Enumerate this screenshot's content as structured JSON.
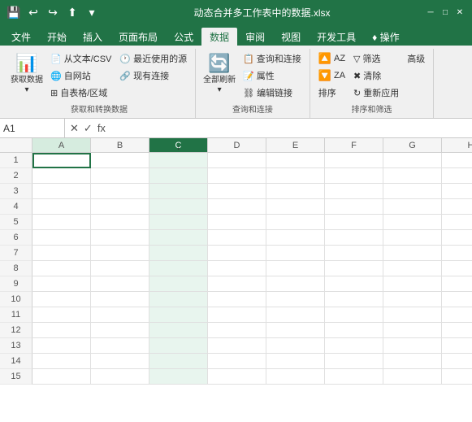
{
  "titlebar": {
    "filename": "动态合并多工作表中的数据.xlsx",
    "save_icon": "💾",
    "undo_icon": "↩",
    "redo_icon": "↪",
    "upload_icon": "⬆",
    "dropdown_icon": "▾"
  },
  "tabs": [
    {
      "label": "文件",
      "active": false
    },
    {
      "label": "开始",
      "active": false
    },
    {
      "label": "插入",
      "active": false
    },
    {
      "label": "页面布局",
      "active": false
    },
    {
      "label": "公式",
      "active": false
    },
    {
      "label": "数据",
      "active": true
    },
    {
      "label": "审阅",
      "active": false
    },
    {
      "label": "视图",
      "active": false
    },
    {
      "label": "开发工具",
      "active": false
    },
    {
      "label": "♦ 操作",
      "active": false
    }
  ],
  "ribbon": {
    "groups": [
      {
        "name": "获取和转换数据",
        "label": "获取和转换数据",
        "buttons": {
          "large": [
            {
              "label": "获取数据\n▾",
              "icon": "📊"
            }
          ],
          "small_col1": [
            {
              "label": "从文本/CSV",
              "icon": "📄"
            },
            {
              "label": "自网站",
              "icon": "🌐"
            },
            {
              "label": "自表格/区域",
              "icon": "⊞"
            }
          ],
          "small_col2": [
            {
              "label": "最近使用的源",
              "icon": "🕐"
            },
            {
              "label": "现有连接",
              "icon": "🔗"
            }
          ]
        }
      },
      {
        "name": "查询和连接",
        "label": "查询和连接",
        "buttons": {
          "large": [
            {
              "label": "全部刷新\n▾",
              "icon": "🔄"
            }
          ],
          "small_col1": [
            {
              "label": "查询和连接",
              "icon": "📋"
            },
            {
              "label": "属性",
              "icon": "📝"
            },
            {
              "label": "编辑链接",
              "icon": "🔗"
            }
          ]
        }
      },
      {
        "name": "排序和筛选",
        "label": "排序和筛选",
        "buttons": {
          "sort_az": {
            "label": "↑AZ",
            "icon": ""
          },
          "sort_za": {
            "label": "↓ZA",
            "icon": ""
          },
          "sort": {
            "label": "排序",
            "icon": ""
          },
          "filter": {
            "label": "筛选",
            "icon": ""
          },
          "clear": {
            "label": "清除",
            "icon": ""
          },
          "reapply": {
            "label": "重新应用",
            "icon": ""
          },
          "advanced": {
            "label": "高级",
            "icon": ""
          }
        }
      }
    ]
  },
  "formula_bar": {
    "name_box": "A1",
    "cancel_label": "✕",
    "confirm_label": "✓",
    "function_label": "fx"
  },
  "columns": [
    "A",
    "B",
    "C",
    "D",
    "E",
    "F",
    "G",
    "H"
  ],
  "active_col": "C",
  "active_cell": {
    "row": 1,
    "col": "A"
  },
  "rows": [
    1,
    2,
    3,
    4,
    5,
    6,
    7,
    8,
    9,
    10,
    11,
    12,
    13,
    14,
    15
  ]
}
